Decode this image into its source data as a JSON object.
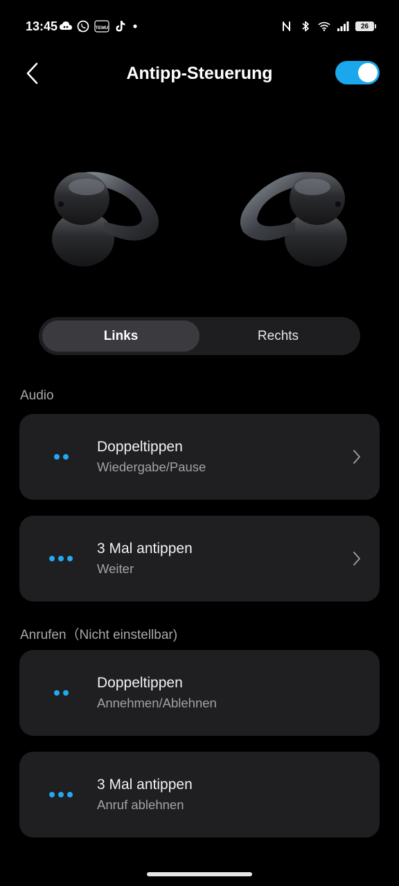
{
  "status_bar": {
    "time": "13:45",
    "left_icons": [
      "cloud-game-icon",
      "whatsapp-icon",
      "temu-icon",
      "tiktok-icon",
      "dot-icon"
    ],
    "temu_label": "TEMU",
    "right_icons": [
      "nfc-icon",
      "bluetooth-icon",
      "wifi-icon",
      "signal-icon",
      "battery-icon"
    ],
    "battery_level": "26"
  },
  "header": {
    "title": "Antipp-Steuerung",
    "back_icon": "chevron-left-icon",
    "toggle_on": true,
    "accent_color": "#1aa7ec"
  },
  "tabs": {
    "items": [
      {
        "label": "Links",
        "active": true
      },
      {
        "label": "Rechts",
        "active": false
      }
    ]
  },
  "audio": {
    "label": "Audio",
    "items": [
      {
        "title": "Doppeltippen",
        "subtitle": "Wiedergabe/Pause",
        "dots": 2,
        "chevron": true
      },
      {
        "title": "3 Mal antippen",
        "subtitle": "Weiter",
        "dots": 3,
        "chevron": true
      }
    ]
  },
  "calls": {
    "label": "Anrufen（Nicht einstellbar)",
    "items": [
      {
        "title": "Doppeltippen",
        "subtitle": "Annehmen/Ablehnen",
        "dots": 2,
        "chevron": false
      },
      {
        "title": "3 Mal antippen",
        "subtitle": "Anruf ablehnen",
        "dots": 3,
        "chevron": false
      }
    ]
  },
  "colors": {
    "background": "#000000",
    "card": "#1f1f22",
    "dot_accent": "#23a8f2"
  }
}
